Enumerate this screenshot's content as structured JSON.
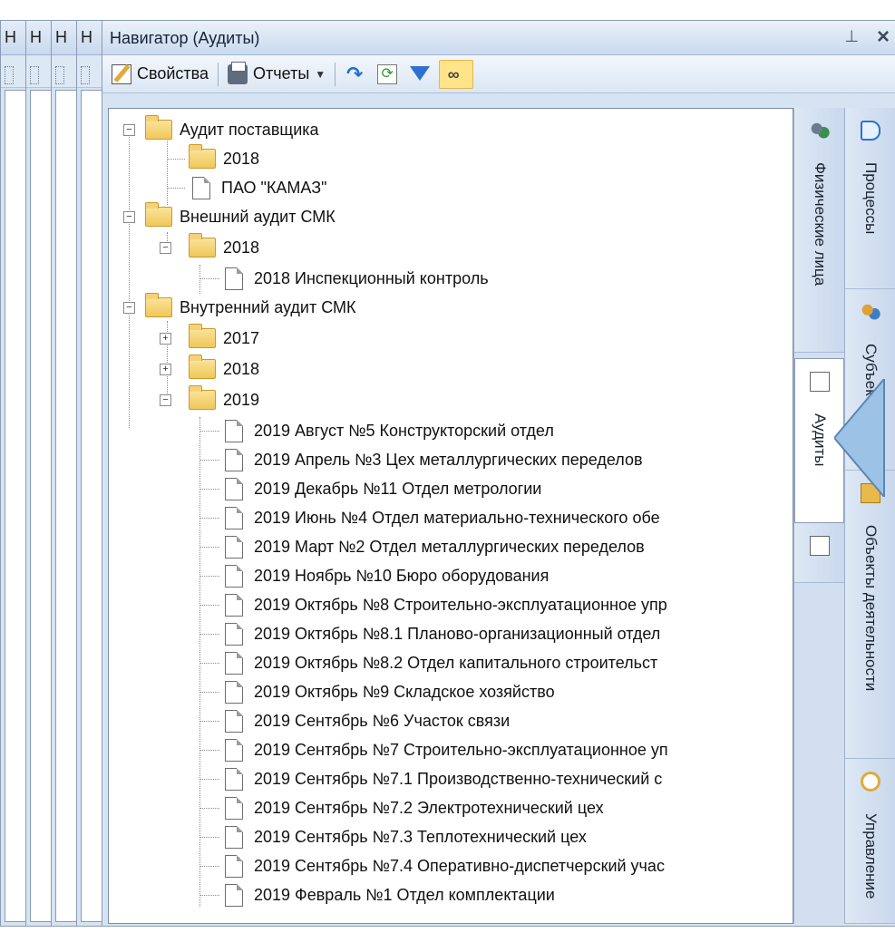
{
  "stack_panels": [
    {
      "header": "Н"
    },
    {
      "header": "Н"
    },
    {
      "header": "Н"
    },
    {
      "header": "Н"
    }
  ],
  "navigator": {
    "title": "Навигатор (Аудиты)",
    "pin_icon": "pin-icon",
    "close_icon": "close-icon",
    "toolbar": {
      "properties_label": "Свойства",
      "reports_label": "Отчеты",
      "icons": [
        "edit-icon",
        "print-icon",
        "redo-icon",
        "refresh-icon",
        "filter-icon",
        "link-icon"
      ]
    }
  },
  "tree": {
    "nodes": [
      {
        "label": "Аудит поставщика",
        "type": "folder"
      },
      {
        "label": "2018",
        "type": "folder"
      },
      {
        "label": "ПАО \"КАМАЗ\"",
        "type": "doc"
      },
      {
        "label": "Внешний аудит СМК",
        "type": "folder"
      },
      {
        "label": "2018",
        "type": "folder"
      },
      {
        "label": "2018 Инспекционный контроль",
        "type": "doc"
      },
      {
        "label": "Внутренний аудит СМК",
        "type": "folder"
      },
      {
        "label": "2017",
        "type": "folder"
      },
      {
        "label": "2018",
        "type": "folder"
      },
      {
        "label": "2019",
        "type": "folder"
      },
      {
        "label": "2019 Август №5 Конструкторский отдел",
        "type": "doc"
      },
      {
        "label": "2019 Апрель №3 Цех металлургических переделов",
        "type": "doc"
      },
      {
        "label": "2019 Декабрь №11 Отдел метрологии",
        "type": "doc"
      },
      {
        "label": "2019 Июнь №4 Отдел материально-технического обе",
        "type": "doc"
      },
      {
        "label": "2019 Март №2 Отдел металлургических переделов",
        "type": "doc"
      },
      {
        "label": "2019 Ноябрь №10 Бюро оборудования",
        "type": "doc"
      },
      {
        "label": "2019 Октябрь №8 Строительно-эксплуатационное упр",
        "type": "doc"
      },
      {
        "label": "2019 Октябрь №8.1 Планово-организационный отдел",
        "type": "doc"
      },
      {
        "label": "2019 Октябрь №8.2 Отдел капитального строительст",
        "type": "doc"
      },
      {
        "label": "2019 Октябрь №9 Складское хозяйство",
        "type": "doc"
      },
      {
        "label": "2019 Сентябрь №6 Участок связи",
        "type": "doc"
      },
      {
        "label": "2019 Сентябрь №7 Строительно-эксплуатационное уп",
        "type": "doc"
      },
      {
        "label": "2019 Сентябрь №7.1 Производственно-технический с",
        "type": "doc"
      },
      {
        "label": "2019 Сентябрь №7.2 Электротехнический цех",
        "type": "doc"
      },
      {
        "label": "2019 Сентябрь №7.3 Теплотехнический цех",
        "type": "doc"
      },
      {
        "label": "2019 Сентябрь №7.4 Оперативно-диспетчерский учас",
        "type": "doc"
      },
      {
        "label": "2019 Февраль №1 Отдел комплектации",
        "type": "doc"
      }
    ]
  },
  "tabs_inner": [
    {
      "label": "Физические лица",
      "icon": "people-icon",
      "active": false
    },
    {
      "label": "Аудиты",
      "icon": "audit-icon",
      "active": true
    },
    {
      "label": "",
      "icon": "new-doc-icon",
      "active": false
    }
  ],
  "tabs_outer": [
    {
      "label": "Процессы",
      "icon": "process-icon"
    },
    {
      "label": "Субъекты",
      "icon": "subjects-icon"
    },
    {
      "label": "Объекты деятельности",
      "icon": "objects-icon"
    },
    {
      "label": "Управление",
      "icon": "management-icon"
    }
  ],
  "colors": {
    "panel_bg": "#d6e3f3",
    "active_button": "#ffe48a",
    "callout": "#9cc3e6"
  }
}
